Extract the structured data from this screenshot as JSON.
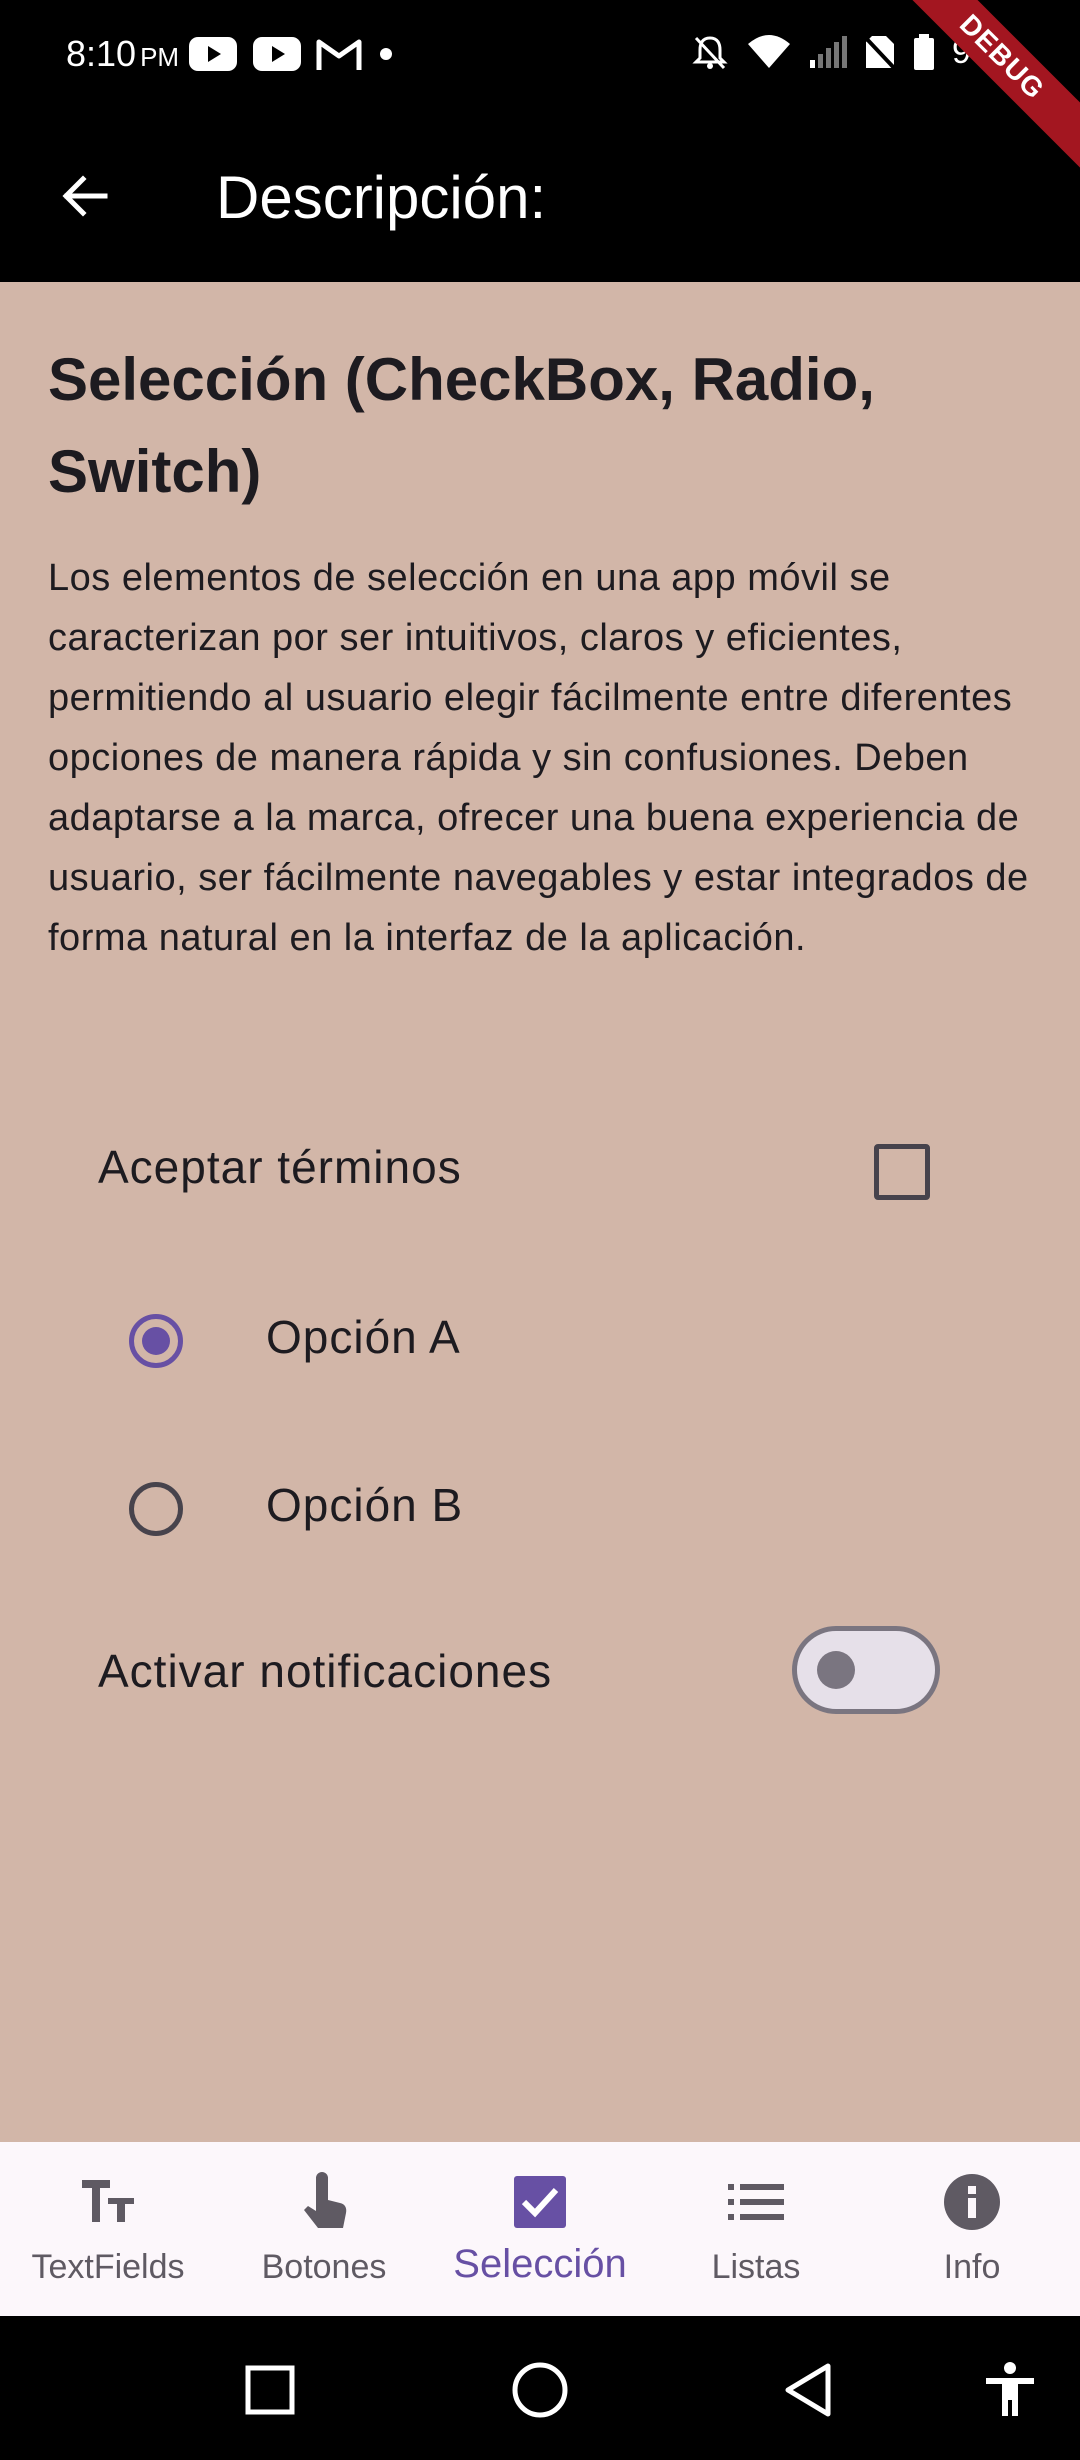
{
  "status_bar": {
    "time": "8:10",
    "ampm": "PM",
    "battery": "99%",
    "notification_icons": [
      "youtube-icon",
      "youtube-icon",
      "gmail-icon",
      "dot-icon"
    ],
    "system_icons": [
      "bell-off-icon",
      "wifi-icon",
      "signal-icon",
      "no-sim-icon",
      "battery-icon"
    ]
  },
  "debug_banner": "DEBUG",
  "app_bar": {
    "title": "Descripción:",
    "back_icon": "arrow-left-icon"
  },
  "content": {
    "heading": "Selección (CheckBox, Radio, Switch)",
    "description": "Los elementos de selección en una app móvil se caracterizan por ser intuitivos, claros y eficientes, permitiendo al usuario elegir fácilmente entre diferentes opciones de manera rápida y sin confusiones. Deben adaptarse a la marca, ofrecer una buena experiencia de usuario, ser fácilmente navegables y estar integrados de forma natural en la interfaz de la aplicación.",
    "checkbox": {
      "label": "Aceptar términos",
      "checked": false
    },
    "radios": [
      {
        "label": "Opción A",
        "selected": true
      },
      {
        "label": "Opción B",
        "selected": false
      }
    ],
    "switch": {
      "label": "Activar notificaciones",
      "on": false
    }
  },
  "bottom_nav": {
    "items": [
      {
        "label": "TextFields",
        "icon": "text-fields-icon",
        "active": false
      },
      {
        "label": "Botones",
        "icon": "touch-icon",
        "active": false
      },
      {
        "label": "Selección",
        "icon": "check-box-icon",
        "active": true
      },
      {
        "label": "Listas",
        "icon": "list-icon",
        "active": false
      },
      {
        "label": "Info",
        "icon": "info-icon",
        "active": false
      }
    ]
  },
  "system_nav": [
    "recents-icon",
    "home-icon",
    "back-icon",
    "accessibility-icon"
  ],
  "colors": {
    "background": "#d2b6a8",
    "accent": "#6750a4",
    "bar": "#000000",
    "nav_background": "#fcf7fb",
    "debug": "#a31620"
  }
}
